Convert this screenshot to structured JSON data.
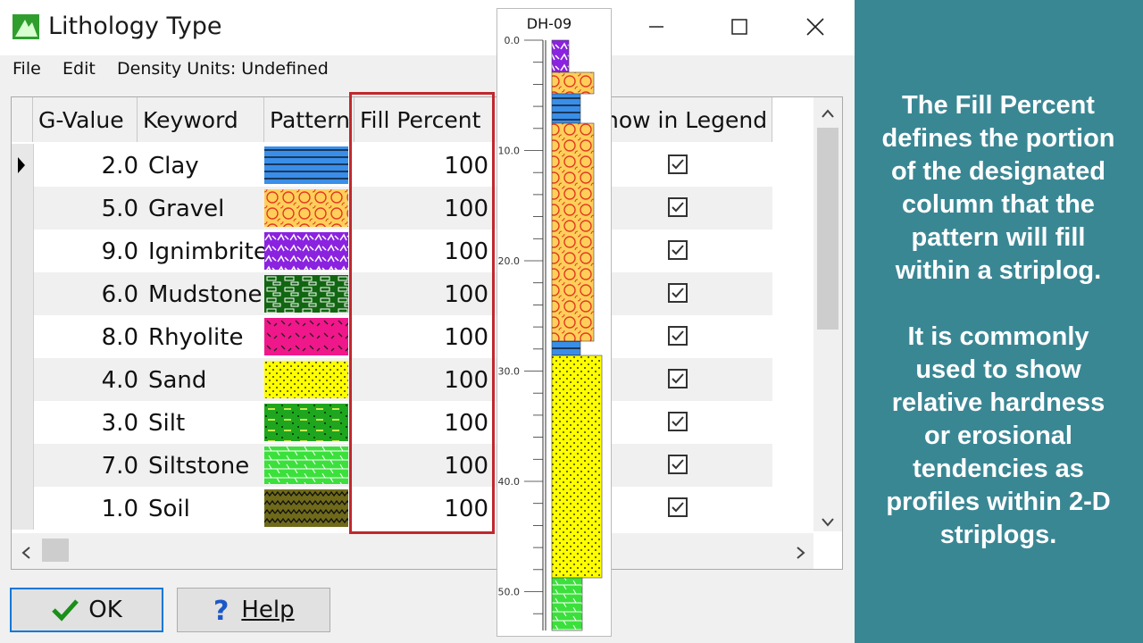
{
  "window": {
    "title": "Lithology Type"
  },
  "menu": {
    "file": "File",
    "edit": "Edit",
    "density": "Density Units: Undefined"
  },
  "columns": {
    "gvalue": "G-Value",
    "keyword": "Keyword",
    "pattern": "Pattern",
    "fill": "Fill Percent",
    "legend": "Show in Legend",
    "legend_visible": "how in Legend"
  },
  "rows": [
    {
      "g": "2.0",
      "keyword": "Clay",
      "fill": "100",
      "pattern": "clay-pattern"
    },
    {
      "g": "5.0",
      "keyword": "Gravel",
      "fill": "100",
      "pattern": "gravel-pattern"
    },
    {
      "g": "9.0",
      "keyword": "Ignimbrite",
      "fill": "100",
      "pattern": "ignimbrite-pattern"
    },
    {
      "g": "6.0",
      "keyword": "Mudstone",
      "fill": "100",
      "pattern": "mudstone-pattern"
    },
    {
      "g": "8.0",
      "keyword": "Rhyolite",
      "fill": "100",
      "pattern": "rhyolite-pattern"
    },
    {
      "g": "4.0",
      "keyword": "Sand",
      "fill": "100",
      "pattern": "sand-pattern"
    },
    {
      "g": "3.0",
      "keyword": "Silt",
      "fill": "100",
      "pattern": "silt-pattern"
    },
    {
      "g": "7.0",
      "keyword": "Siltstone",
      "fill": "100",
      "pattern": "siltstone-pattern"
    },
    {
      "g": "1.0",
      "keyword": "Soil",
      "fill": "100",
      "pattern": "soil-pattern"
    }
  ],
  "buttons": {
    "ok": "OK",
    "help": "Help"
  },
  "striplog": {
    "title": "DH-09",
    "ticks": [
      "0.0",
      "10.0",
      "20.0",
      "30.0",
      "40.0",
      "50.0"
    ]
  },
  "panel": {
    "para1": [
      "The Fill Percent",
      "defines the portion",
      "of the designated",
      "column that the",
      "pattern will fill",
      "within a striplog."
    ],
    "para2": [
      "It is commonly",
      "used to show",
      "relative hardness",
      "or erosional",
      "tendencies as",
      "profiles within 2-D",
      "striplogs."
    ]
  },
  "colors": {
    "accent_panel": "#3a8794",
    "highlight": "#c0282d",
    "ok_border": "#0a78d7"
  }
}
